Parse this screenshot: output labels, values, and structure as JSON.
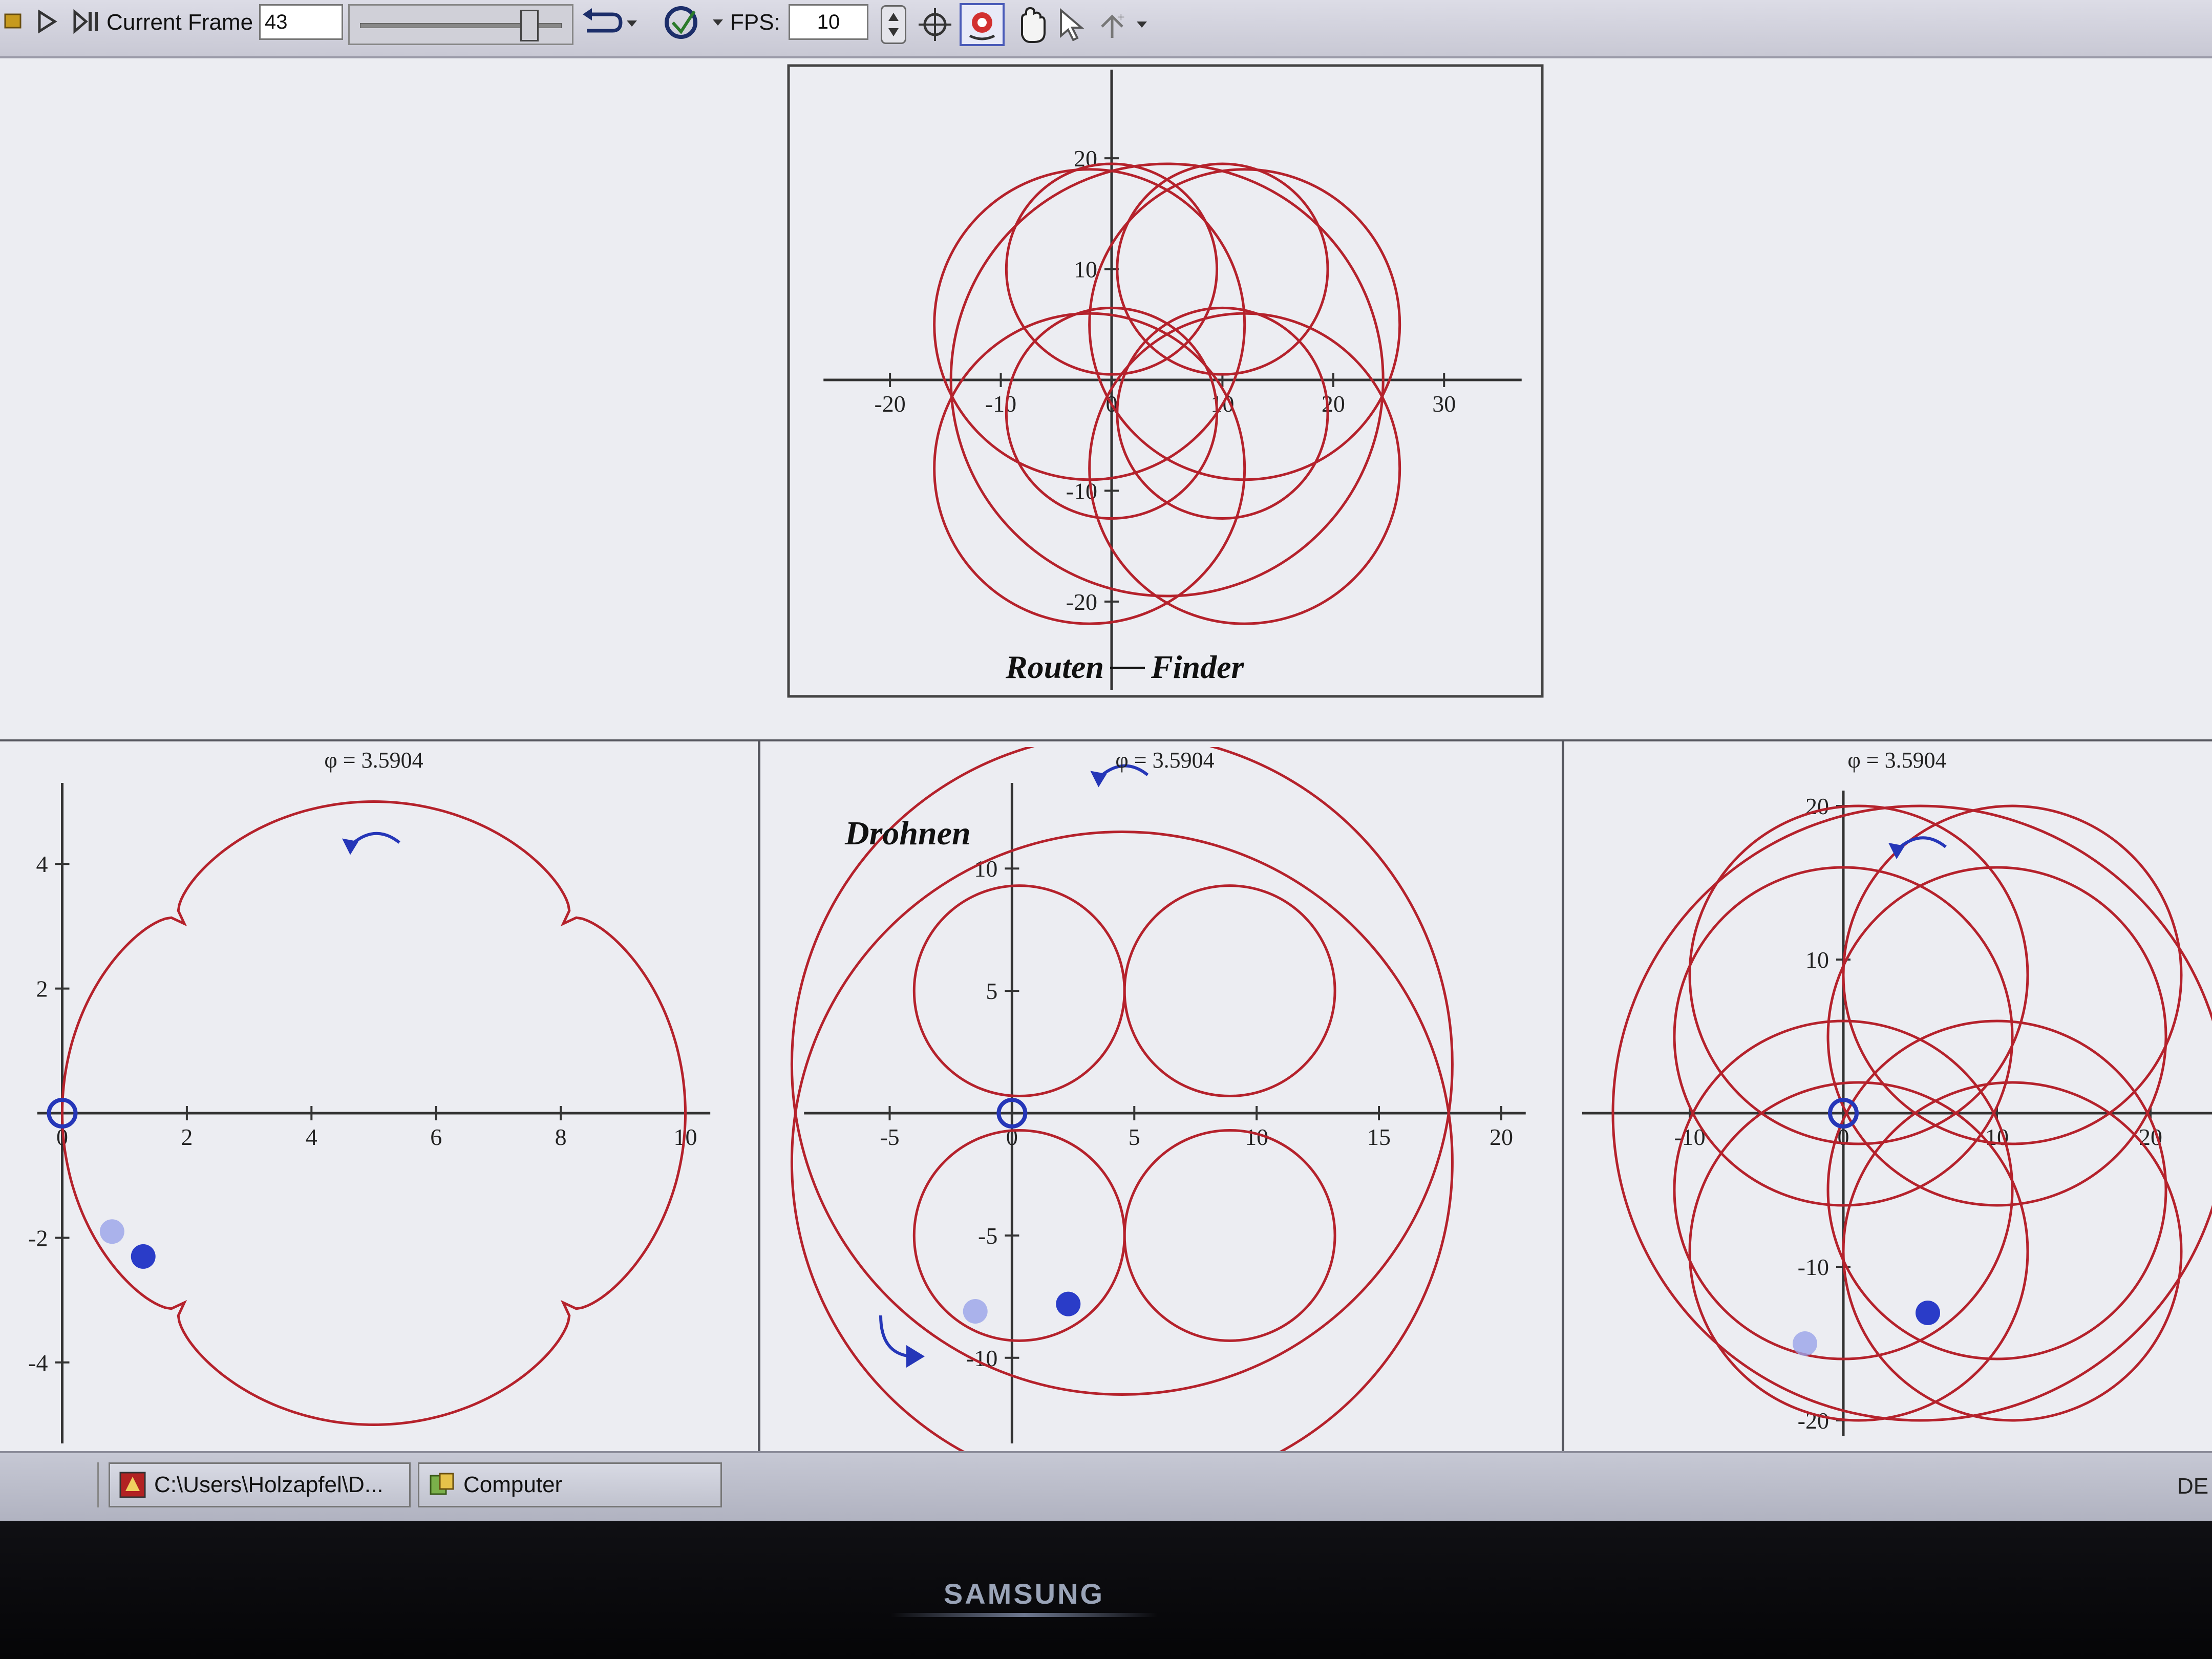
{
  "toolbar": {
    "current_frame_label": "Current Frame",
    "current_frame_value": "43",
    "fps_label": "FPS:",
    "fps_value": "10",
    "slider_position_fraction": 0.86,
    "icons": [
      "stop-icon",
      "play-icon",
      "step-forward-icon",
      "loop-icon",
      "direction-icon",
      "zoom-target-icon",
      "color-point-icon",
      "pan-hand-icon",
      "pointer-icon",
      "scale-icon"
    ]
  },
  "plots": {
    "top": {
      "annotation_left": "Routen",
      "annotation_right": "Finder"
    },
    "bottom_left": {
      "title": "φ = 3.5904"
    },
    "bottom_middle": {
      "title": "φ = 3.5904",
      "annotation": "Drohnen"
    },
    "bottom_right": {
      "title": "φ = 3.5904"
    }
  },
  "chart_data": [
    {
      "type": "line",
      "name": "top-plot",
      "xlim": [
        -26,
        37
      ],
      "ylim": [
        -28,
        28
      ],
      "xticks": [
        -20,
        -10,
        0,
        10,
        20,
        30
      ],
      "yticks": [
        -20,
        -10,
        10,
        20
      ],
      "annotation": "Routen — Finder",
      "curves": [
        {
          "shape": "circle",
          "cx": 5,
          "cy": 0,
          "r": 19.5
        },
        {
          "shape": "circle",
          "cx": 0,
          "cy": 10,
          "r": 9.5
        },
        {
          "shape": "circle",
          "cx": 10,
          "cy": 10,
          "r": 9.5
        },
        {
          "shape": "circle",
          "cx": 0,
          "cy": -3,
          "r": 9.5
        },
        {
          "shape": "circle",
          "cx": 10,
          "cy": -3,
          "r": 9.5
        },
        {
          "shape": "circle",
          "cx": -2,
          "cy": 5,
          "r": 14
        },
        {
          "shape": "circle",
          "cx": 12,
          "cy": 5,
          "r": 14
        },
        {
          "shape": "circle",
          "cx": -2,
          "cy": -8,
          "r": 14
        },
        {
          "shape": "circle",
          "cx": 12,
          "cy": -8,
          "r": 14
        }
      ],
      "color": "#b5222c"
    },
    {
      "type": "line",
      "name": "bottom-left-plot",
      "title": "φ = 3.5904",
      "xlim": [
        -0.4,
        10.4
      ],
      "ylim": [
        -5.3,
        5.3
      ],
      "xticks": [
        0,
        2,
        4,
        6,
        8,
        10
      ],
      "yticks": [
        -4,
        -2,
        2,
        4
      ],
      "curves": [
        {
          "shape": "quatrefoil",
          "cx": 5,
          "cy": 0,
          "r": 5
        }
      ],
      "points": [
        {
          "x": 0,
          "y": 0,
          "style": "open-circle"
        },
        {
          "x": 1.3,
          "y": -2.3,
          "style": "filled"
        },
        {
          "x": 0.8,
          "y": -1.9,
          "style": "faded"
        }
      ],
      "color": "#b5222c"
    },
    {
      "type": "line",
      "name": "bottom-middle-plot",
      "title": "φ = 3.5904",
      "annotation": "Drohnen",
      "xlim": [
        -8.5,
        21
      ],
      "ylim": [
        -13.5,
        13.5
      ],
      "xticks": [
        -5,
        0,
        5,
        10,
        15,
        20
      ],
      "yticks": [
        -10,
        -5,
        5,
        10
      ],
      "curves": [
        {
          "shape": "circle",
          "cx": 4.5,
          "cy": 2,
          "r": 13.5
        },
        {
          "shape": "circle",
          "cx": 4.5,
          "cy": -2,
          "r": 13.5
        },
        {
          "shape": "circle",
          "cx": 0.3,
          "cy": 5,
          "r": 4.3
        },
        {
          "shape": "circle",
          "cx": 8.9,
          "cy": 5,
          "r": 4.3
        },
        {
          "shape": "circle",
          "cx": 0.3,
          "cy": -5,
          "r": 4.3
        },
        {
          "shape": "circle",
          "cx": 8.9,
          "cy": -5,
          "r": 4.3
        }
      ],
      "points": [
        {
          "x": 0,
          "y": 0,
          "style": "open-circle"
        },
        {
          "x": 2.3,
          "y": -7.8,
          "style": "filled"
        },
        {
          "x": -1.5,
          "y": -8.1,
          "style": "faded"
        }
      ],
      "color": "#b5222c"
    },
    {
      "type": "line",
      "name": "bottom-right-plot",
      "title": "φ = 3.5904",
      "xlim": [
        -17,
        24
      ],
      "ylim": [
        -21,
        21
      ],
      "xticks": [
        -10,
        0,
        10,
        20
      ],
      "yticks": [
        -20,
        -10,
        10,
        20
      ],
      "curves": [
        {
          "shape": "circle",
          "cx": 5,
          "cy": 0,
          "r": 20
        },
        {
          "shape": "circle",
          "cx": 0,
          "cy": 5,
          "r": 11
        },
        {
          "shape": "circle",
          "cx": 10,
          "cy": 5,
          "r": 11
        },
        {
          "shape": "circle",
          "cx": 0,
          "cy": -5,
          "r": 11
        },
        {
          "shape": "circle",
          "cx": 10,
          "cy": -5,
          "r": 11
        },
        {
          "shape": "circle",
          "cx": 1,
          "cy": 9,
          "r": 11
        },
        {
          "shape": "circle",
          "cx": 11,
          "cy": 9,
          "r": 11
        },
        {
          "shape": "circle",
          "cx": 1,
          "cy": -9,
          "r": 11
        },
        {
          "shape": "circle",
          "cx": 11,
          "cy": -9,
          "r": 11
        }
      ],
      "points": [
        {
          "x": 0,
          "y": 0,
          "style": "open-circle"
        },
        {
          "x": 5.5,
          "y": -13,
          "style": "filled"
        },
        {
          "x": -2.5,
          "y": -15,
          "style": "faded"
        }
      ],
      "color": "#b5222c"
    }
  ],
  "taskbar": {
    "items": [
      {
        "label": "C:\\Users\\Holzapfel\\D..."
      },
      {
        "label": "Computer"
      }
    ],
    "tray_text": "DE"
  },
  "monitor": {
    "brand": "SAMSUNG"
  }
}
